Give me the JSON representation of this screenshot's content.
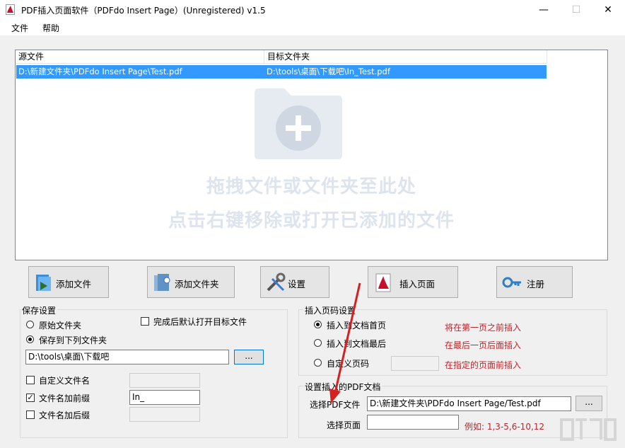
{
  "window": {
    "title": "PDF插入页面软件（PDFdo Insert Page）(Unregistered) v1.5",
    "minimize": "—",
    "maximize": "☐",
    "close": "✕"
  },
  "menu": [
    "文件",
    "帮助"
  ],
  "file_list": {
    "columns": [
      "源文件",
      "目标文件夹"
    ],
    "rows": [
      {
        "source": "D:\\新建文件夹\\PDFdo Insert Page\\Test.pdf",
        "target": "D:\\tools\\桌面\\下载吧\\In_Test.pdf",
        "selected": true
      }
    ],
    "watermark_line1": "拖拽文件或文件夹至此处",
    "watermark_line2": "点击右键移除或打开已添加的文件"
  },
  "toolbar": {
    "add_file": "添加文件",
    "add_folder": "添加文件夹",
    "settings": "设置",
    "insert_page": "插入页面",
    "register": "注册"
  },
  "save_settings": {
    "title": "保存设置",
    "original_folder": "原始文件夹",
    "save_to_folder": "保存到下列文件夹",
    "open_after": "完成后默认打开目标文件",
    "folder_path": "D:\\tools\\桌面\\下载吧",
    "browse": "...",
    "custom_name": "自定义文件名",
    "custom_name_value": "",
    "add_prefix": "文件名加前缀",
    "prefix_value": "In_",
    "add_suffix": "文件名加后缀",
    "suffix_value": ""
  },
  "insert_settings": {
    "title": "插入页码设置",
    "at_first": "插入到文档首页",
    "at_first_hint": "将在第一页之前插入",
    "at_last": "插入到文档最后",
    "at_last_hint": "在最后一页后面插入",
    "custom_page": "自定义页码",
    "custom_page_value": "",
    "custom_page_hint": "在指定的页面前插入"
  },
  "insert_pdf": {
    "title": "设置插入的PDF文档",
    "select_file_label": "选择PDF文件",
    "select_file_value": "D:\\新建文件夹\\PDFdo Insert Page/Test.pdf",
    "browse": "...",
    "select_pages_label": "选择页面",
    "select_pages_value": "",
    "pages_example": "例如: 1,3-5,6-10,12"
  },
  "colors": {
    "selection": "#3399ff",
    "hint_red": "#c0232a",
    "annotation_arrow": "#d42020"
  }
}
